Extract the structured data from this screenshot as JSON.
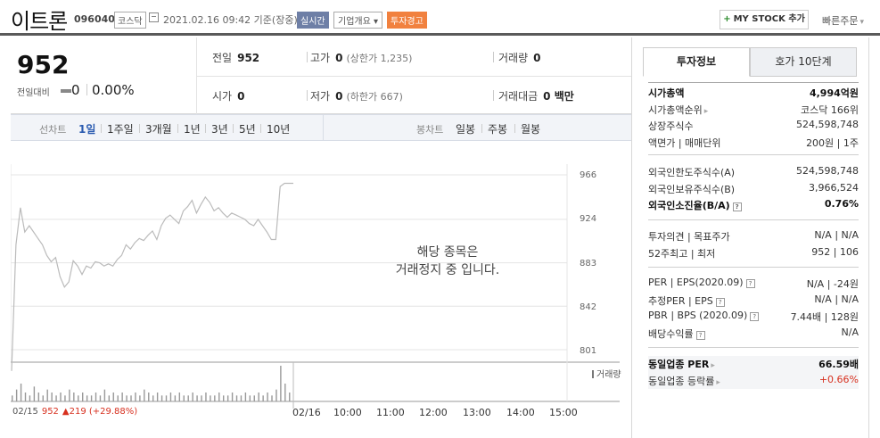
{
  "header": {
    "name": "이트론",
    "code": "096040",
    "market": "코스닥",
    "datetime": "2021.02.16 09:42 기준(장중)",
    "realtime": "실시간",
    "company_info": "기업개요",
    "warning": "투자경고",
    "mystock": "MY STOCK 추가",
    "quick": "빠른주문"
  },
  "summary": {
    "price": "952",
    "change_label": "전일대비",
    "change_value": "0",
    "change_pct": "0.00%",
    "prev_close_label": "전일",
    "prev_close": "952",
    "high_label": "고가",
    "high": "0",
    "upper_limit": "(상한가 1,235)",
    "volume_label": "거래량",
    "volume": "0",
    "open_label": "시가",
    "open": "0",
    "low_label": "저가",
    "low": "0",
    "lower_limit": "(하한가 667)",
    "value_label": "거래대금",
    "value": "0 백만"
  },
  "toolbar": {
    "line_label": "선차트",
    "line_items": [
      "1일",
      "1주일",
      "3개월",
      "1년",
      "3년",
      "5년",
      "10년"
    ],
    "candle_label": "봉차트",
    "candle_items": [
      "일봉",
      "주봉",
      "월봉"
    ]
  },
  "chart": {
    "y_ticks": [
      "966",
      "924",
      "883",
      "842",
      "801"
    ],
    "message_line1": "해당 종목은",
    "message_line2": "거래정지 중 입니다.",
    "volume_label": "거래량",
    "x_start": "02/15",
    "x_start_price": "952",
    "x_start_change": "▲219 (+29.88%)",
    "x_labels": [
      "02/16",
      "10:00",
      "11:00",
      "12:00",
      "13:00",
      "14:00",
      "15:00"
    ],
    "accent": "#d7301f",
    "line_color": "#bbbbbb"
  },
  "chart_data": {
    "type": "line",
    "title": "",
    "ylim": [
      801,
      966
    ],
    "y_ticks": [
      966,
      924,
      883,
      842,
      801
    ],
    "x_ticks": [
      "02/15",
      "02/16",
      "10:00",
      "11:00",
      "12:00",
      "13:00",
      "14:00",
      "15:00"
    ],
    "series": [
      {
        "values": [
          733,
          900,
          935,
          912,
          918,
          912,
          906,
          900,
          890,
          884,
          888,
          870,
          860,
          865,
          885,
          880,
          872,
          880,
          878,
          884,
          883,
          880,
          882,
          880,
          886,
          890,
          900,
          896,
          902,
          906,
          904,
          909,
          913,
          905,
          918,
          925,
          928,
          924,
          920,
          932,
          936,
          942,
          930,
          938,
          945,
          940,
          932,
          935,
          930,
          926,
          930,
          928,
          926,
          924,
          920,
          918,
          924,
          918,
          912,
          905,
          905,
          955,
          958,
          958,
          958
        ]
      }
    ],
    "volume": [
      2,
      4,
      6,
      3,
      2,
      5,
      3,
      2,
      4,
      3,
      2,
      3,
      2,
      4,
      3,
      2,
      3,
      2,
      2,
      3,
      2,
      4,
      2,
      3,
      2,
      3,
      2,
      2,
      3,
      2,
      4,
      3,
      2,
      3,
      2,
      2,
      3,
      2,
      3,
      2,
      2,
      3,
      2,
      2,
      3,
      2,
      2,
      3,
      2,
      2,
      3,
      2,
      2,
      3,
      2,
      2,
      3,
      2,
      3,
      2,
      4,
      12,
      6,
      3
    ]
  },
  "tabs": {
    "active": "투자정보",
    "other": "호가 10단계"
  },
  "info": {
    "g1": [
      {
        "k": "시가총액",
        "v": "4,994억원",
        "bold": true
      },
      {
        "k": "시가총액순위",
        "v": "코스닥 166위",
        "arrow": true
      },
      {
        "k": "상장주식수",
        "v": "524,598,748"
      },
      {
        "k": "액면가 | 매매단위",
        "v": "200원 | 1주"
      }
    ],
    "g2": [
      {
        "k": "외국인한도주식수(A)",
        "v": "524,598,748"
      },
      {
        "k": "외국인보유주식수(B)",
        "v": "3,966,524"
      },
      {
        "k": "외국인소진율(B/A)",
        "v": "0.76%",
        "bold": true,
        "q": true
      }
    ],
    "g3": [
      {
        "k": "투자의견 | 목표주가",
        "v": "N/A | N/A"
      },
      {
        "k": "52주최고 | 최저",
        "v": "952 | 106"
      }
    ],
    "g4": [
      {
        "k": "PER | EPS(2020.09)",
        "v": "N/A | -24원",
        "q": true
      },
      {
        "k": "추정PER | EPS",
        "v": "N/A | N/A",
        "q": true
      },
      {
        "k": "PBR | BPS (2020.09)",
        "v": "7.44배 | 128원",
        "q": true
      },
      {
        "k": "배당수익률",
        "v": "N/A",
        "q": true
      }
    ],
    "g5": [
      {
        "k": "동일업종 PER",
        "v": "66.59배",
        "bold": true,
        "arrow": true
      },
      {
        "k": "동일업종 등락률",
        "v": "+0.66%",
        "red": true,
        "arrow": true
      }
    ]
  }
}
